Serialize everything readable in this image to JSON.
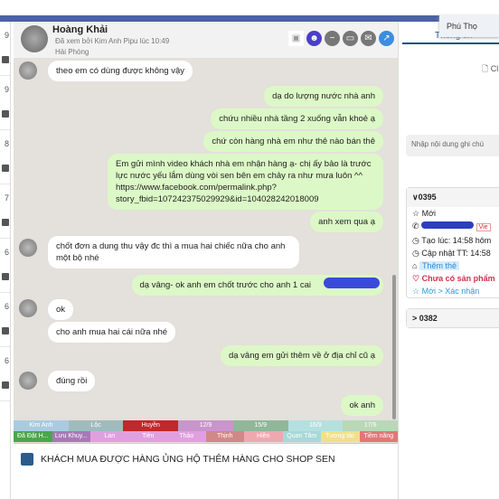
{
  "sidebar": {
    "items": [
      "9",
      "9",
      "8",
      "7",
      "6",
      "6",
      "6"
    ]
  },
  "header": {
    "name": "Hoàng Khải",
    "seen": "Đã xem bởi Kim Anh Pipu lúc 10:49",
    "location": "Hải Phòng"
  },
  "tooltip": "Phú Thọ",
  "messages": [
    {
      "dir": "in",
      "text": "theo em có dùng được không vậy"
    },
    {
      "dir": "out",
      "text": "dạ do lượng nước nhà anh"
    },
    {
      "dir": "out",
      "text": "chứu nhiều nhà tầng 2 xuống vẫn khoẻ ạ"
    },
    {
      "dir": "out",
      "text": "chứ còn hàng nhà em như thê nào bán thê"
    },
    {
      "dir": "out",
      "text": "Em gửi mình video khách nhà em nhận hàng ạ- chị ấy bảo là trước lực nước yếu lắm dùng vòi sen bên em chảy ra như mưa luôn ^^ https://www.facebook.com/permalink.php?story_fbid=107242375029929&id=104028242018009"
    },
    {
      "dir": "out",
      "text": "anh xem qua ạ"
    },
    {
      "dir": "in",
      "text": "chốt đơn a dung thu vậy đc thì a mua hai chiếc nữa cho anh một bộ nhé"
    },
    {
      "dir": "out",
      "text": "dạ vâng- ok anh em chốt trước cho anh 1 cai"
    },
    {
      "dir": "in",
      "text": "ok"
    },
    {
      "dir": "in",
      "text": "cho anh mua hai cái nữa nhé"
    },
    {
      "dir": "out",
      "text": "dạ vâng em gửi thêm về ở địa chỉ cũ ạ"
    },
    {
      "dir": "in",
      "text": "đúng rồi"
    },
    {
      "dir": "out",
      "text": "ok anh"
    }
  ],
  "tags_row1": [
    {
      "label": "Kim Anh",
      "color": "#a9cbe0"
    },
    {
      "label": "Lộc",
      "color": "#9fbcbc"
    },
    {
      "label": "Huyền",
      "color": "#c0282a"
    },
    {
      "label": "12/9",
      "color": "#c995cc"
    },
    {
      "label": "15/9",
      "color": "#8fb89a"
    },
    {
      "label": "16/9",
      "color": "#b5e0e0"
    },
    {
      "label": "17/9",
      "color": "#b8d8b8"
    }
  ],
  "tags_row2": [
    {
      "label": "Đã Đặt H...",
      "color": "#4aa64a"
    },
    {
      "label": "Lưu Khuy...",
      "color": "#a878b8"
    },
    {
      "label": "Lan",
      "color": "#e0a0e0"
    },
    {
      "label": "Tiên",
      "color": "#e0a0e0"
    },
    {
      "label": "Thảo",
      "color": "#e0a0e0"
    },
    {
      "label": "Thịnh",
      "color": "#d08888"
    },
    {
      "label": "Hiền",
      "color": "#f0a8b0"
    },
    {
      "label": "Quan Tâm",
      "color": "#a8d8d8"
    },
    {
      "label": "Tương tác",
      "color": "#f0e08a"
    },
    {
      "label": "Tiềm năng",
      "color": "#e07878"
    }
  ],
  "composer": {
    "text": "KHÁCH MUA ĐƯỢC HÀNG ỦNG HỘ THÊM HÀNG CHO SHOP SEN"
  },
  "right": {
    "tab": "Thông tin",
    "note_placeholder": "Nhập nội dung ghi chú",
    "doc_label": "Cl",
    "order1": {
      "id": "0395",
      "status": "Mới",
      "badge": "Vie",
      "created": "Tạo lúc: 14:58 hôm",
      "updated": "Cập nhật TT: 14:58",
      "add_tag": "Thêm thẻ",
      "no_product": "Chưa có sản phẩm",
      "flow": "Mới > Xác nhận"
    },
    "order2": {
      "id": "0382"
    }
  }
}
